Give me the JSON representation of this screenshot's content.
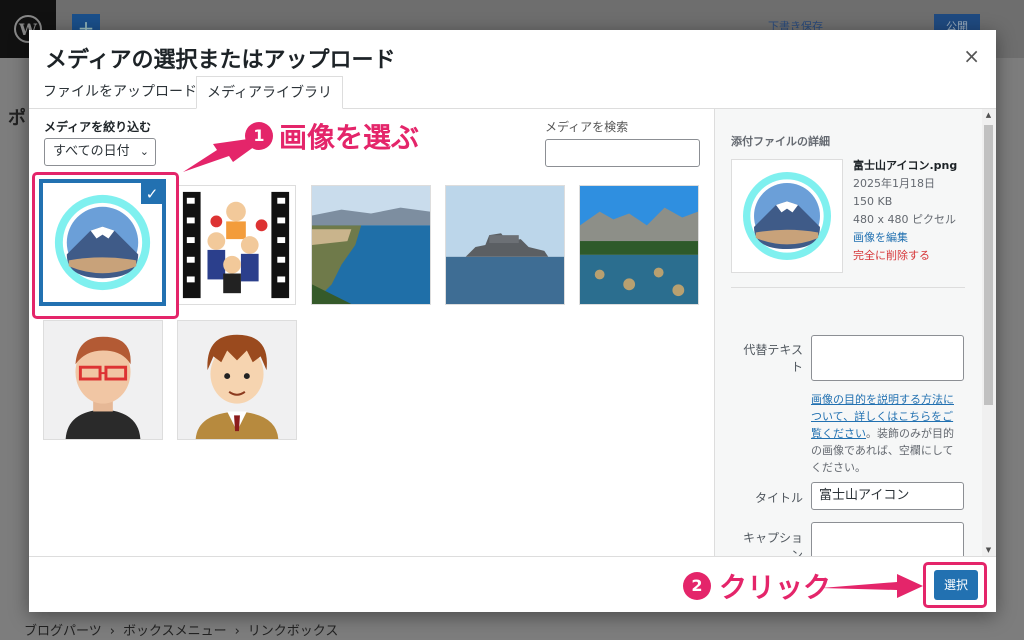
{
  "background": {
    "wp_logo": "W",
    "save_draft": "下書き保存",
    "publish": "公開",
    "page_initial": "ポ",
    "breadcrumb": [
      "ブログパーツ",
      "ボックスメニュー",
      "リンクボックス"
    ],
    "breadcrumb_sep": "›"
  },
  "modal": {
    "title": "メディアの選択またはアップロード",
    "close": "×",
    "tabs": [
      {
        "label": "ファイルをアップロード",
        "active": false
      },
      {
        "label": "メディアライブラリ",
        "active": true
      }
    ],
    "filter_label": "メディアを絞り込む",
    "date_filter": "すべての日付",
    "search_label": "メディアを検索",
    "search_value": "",
    "grid": [
      {
        "name": "fuji-icon",
        "selected": true
      },
      {
        "name": "band-illustration",
        "selected": false
      },
      {
        "name": "coast-photo",
        "selected": false
      },
      {
        "name": "island-photo",
        "selected": false
      },
      {
        "name": "valley-river-photo",
        "selected": false
      },
      {
        "name": "man-glasses-avatar",
        "selected": false
      },
      {
        "name": "man-suit-avatar",
        "selected": false
      }
    ],
    "annotations": {
      "step1_num": "1",
      "step1_text": "画像を選ぶ",
      "step2_num": "2",
      "step2_text": "クリック"
    },
    "details": {
      "heading": "添付ファイルの詳細",
      "filename": "富士山アイコン.png",
      "date": "2025年1月18日",
      "size": "150 KB",
      "dimensions": "480 x 480 ピクセル",
      "edit_link": "画像を編集",
      "delete_link": "完全に削除する",
      "alt_label": "代替テキスト",
      "alt_value": "",
      "alt_help_link": "画像の目的を説明する方法について、詳しくはこちらをご覧ください",
      "alt_help_text": "。装飾のみが目的の画像であれば、空欄にしてください。",
      "title_label": "タイトル",
      "title_value": "富士山アイコン",
      "caption_label": "キャプション",
      "caption_value": ""
    },
    "select_button": "選択"
  },
  "colors": {
    "accent": "#2271b1",
    "annotation": "#e4256a",
    "delete": "#d63638"
  }
}
